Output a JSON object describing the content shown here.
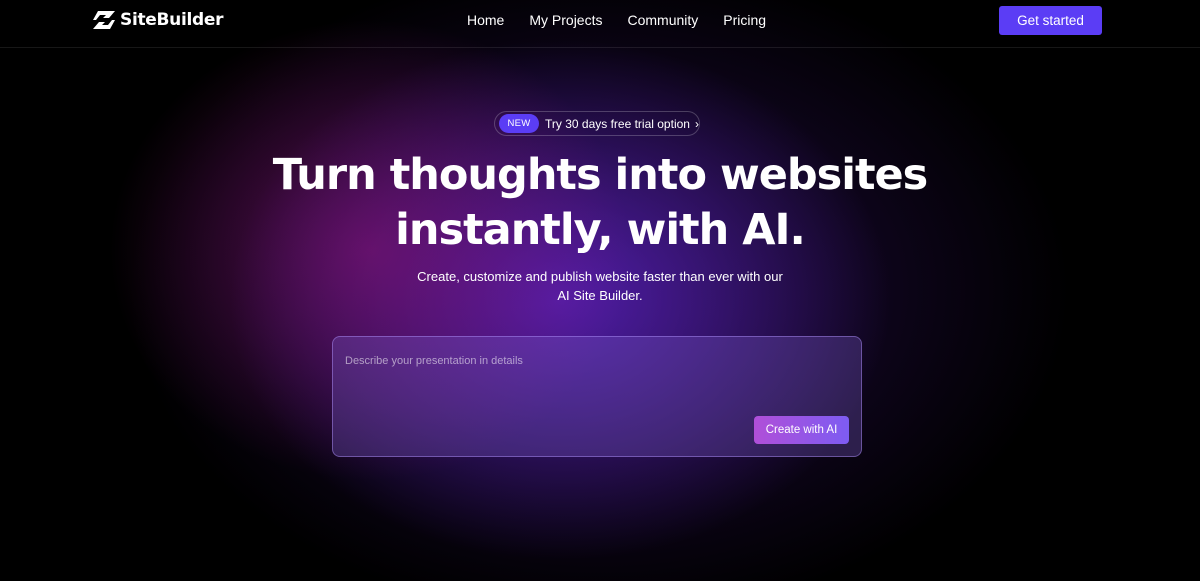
{
  "brand": {
    "name": "SiteBuilder",
    "logo_icon": "bolt-logo-icon"
  },
  "nav": {
    "links": [
      "Home",
      "My Projects",
      "Community",
      "Pricing"
    ],
    "cta_label": "Get started"
  },
  "announcement": {
    "badge": "NEW",
    "text": "Try 30 days free trial option",
    "chevron": "›",
    "chevron_icon": "chevron-right-icon"
  },
  "hero": {
    "headline_line1": "Turn thoughts into websites",
    "headline_line2": "instantly, with AI.",
    "subtitle_line1": "Create, customize and publish website faster than ever with our",
    "subtitle_line2": "AI Site Builder."
  },
  "prompt": {
    "placeholder": "Describe your presentation in details",
    "value": "",
    "submit_label": "Create with AI"
  },
  "colors": {
    "background": "#000000",
    "accent": "#5b3df5",
    "button_gradient_start": "#b04fd8",
    "button_gradient_end": "#7d5cf2",
    "glow_purple": "#5f23c8",
    "glow_magenta": "#961482"
  }
}
